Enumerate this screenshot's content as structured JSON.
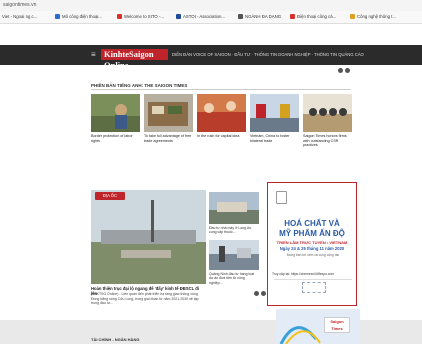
{
  "browser": {
    "url": "saigontimes.vn",
    "bookmarks": [
      {
        "label": "Viet - Ngoai ng c...",
        "color": "#4a8f3a"
      },
      {
        "label": "Mô công điện thoại...",
        "color": "#2b6cd4"
      },
      {
        "label": "Welcome to SITO -...",
        "color": "#d9302c"
      },
      {
        "label": "ASTOI - Association...",
        "color": "#1e4c9a"
      },
      {
        "label": "NGÀNH ĐA DẠNG",
        "color": "#555555"
      },
      {
        "label": "Điện thoại công cả...",
        "color": "#d9302c"
      },
      {
        "label": "Công nghệ thông t...",
        "color": "#e0a020"
      }
    ]
  },
  "header": {
    "logo_text": "KinhteSaigon Online",
    "nav_text": "DIỄN ĐÀN VOICE OF SAIGON  ·  ĐẦU TƯ  ·  THỐNG TIN DOANH NGHIỆP  ·  THÔNG TIN QUẢNG CÁO",
    "menu_icon": "hamburger-icon"
  },
  "english_section": {
    "title": "PHIÊN BẢN TIẾNG ANH: THE SAIGON TIMES",
    "articles": [
      {
        "caption": "Border protection of labor rights"
      },
      {
        "caption": "To take full advantage of free trade agreements"
      },
      {
        "caption": "In the rush for capital idea"
      },
      {
        "caption": "Vietnam, China to foster bilateral trade"
      },
      {
        "caption": "Saigon Times honors firms with outstanding CSR practices"
      }
    ]
  },
  "feature": {
    "tag": "ĐỊA ỐC",
    "title": "Hoàn thiện trục đại lộ ngang để 'đẩy' kinh tế ĐBSCL đi lên",
    "summary": "(TBKTSG Online) - Liên quan đến phát triển hạ tầng giao thông vùng Đồng bằng sông Cửu Long, trong giai đoạn từ năm 2021-2030 sẽ tập trung đầu tư..."
  },
  "side_articles": [
    {
      "caption": "Đầu tư nhà máy ở Long An, cung cấp thuốc..."
    },
    {
      "caption": "Quảng Ninh đầu tư hàng loạt dự án đưa tiền từ công nghiệp..."
    }
  ],
  "ad": {
    "line1": "HOÁ CHẤT VÀ",
    "line2": "MỸ PHẨM ẤN ĐỘ",
    "line3": "TRIỂN LÃM TRỰC TUYẾN • VIETNAM",
    "line4": "Ngày 24 & 25 tháng 11 năm 2020",
    "line5": "Mong bạn tới xem và cùng cộng tác",
    "register": "Truy cập tại: https://chemexcil.tiffexpo.com"
  },
  "ad2": {
    "logo": "Saigon Times"
  },
  "footer_section": {
    "title": "TÀI CHÍNH - NGÂN HÀNG"
  }
}
